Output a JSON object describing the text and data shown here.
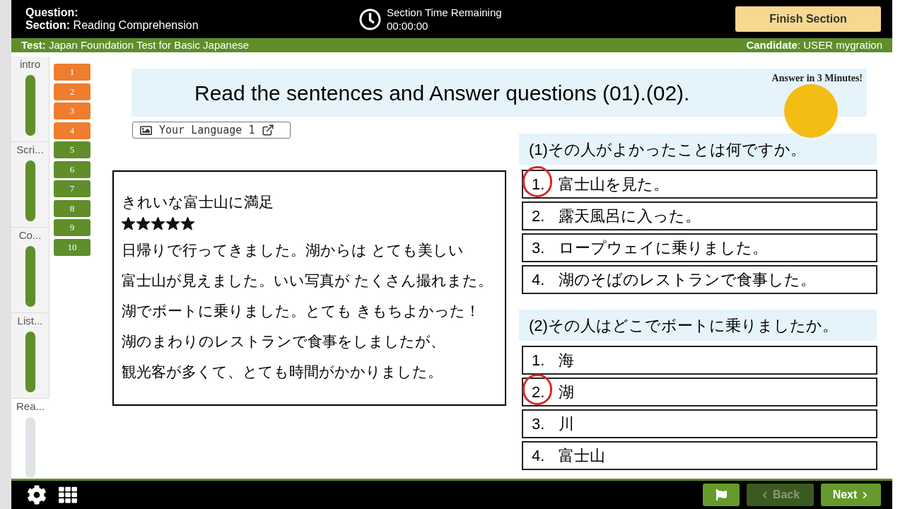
{
  "header": {
    "question_label": "Question:",
    "section": "**Section:** Reading Comprehension",
    "timer_label": "Section Time Remaining",
    "timer_value": "00:00:00",
    "finish_button": "Finish Section"
  },
  "info_bar": {
    "test": "**Test:** Japan Foundation Test for Basic Japanese",
    "candidate": "**Candidate**: USER mygration"
  },
  "sections": [
    {
      "label": "intro",
      "completed": true,
      "selected": false
    },
    {
      "label": "Scri...",
      "completed": true,
      "selected": false
    },
    {
      "label": "Co...",
      "completed": true,
      "selected": false
    },
    {
      "label": "List...",
      "completed": true,
      "selected": false
    },
    {
      "label": "Rea...",
      "completed": false,
      "selected": true
    }
  ],
  "question_nav": [
    {
      "label": "1",
      "color": "#ee7d2e"
    },
    {
      "label": "2",
      "color": "#ee7d2e"
    },
    {
      "label": "3",
      "color": "#ee7d2e"
    },
    {
      "label": "4",
      "color": "#ee7d2e"
    },
    {
      "label": "5",
      "color": "#5f8e2b"
    },
    {
      "label": "6",
      "color": "#5f8e2b"
    },
    {
      "label": "7",
      "color": "#5f8e2b"
    },
    {
      "label": "8",
      "color": "#5f8e2b"
    },
    {
      "label": "9",
      "color": "#5f8e2b"
    },
    {
      "label": "10",
      "color": "#5f8e2b"
    }
  ],
  "instruction": {
    "title": "Read the sentences and Answer questions (01).(02).",
    "time_note": "Answer in 3 Minutes!"
  },
  "language_button": {
    "label": "Your Language 1"
  },
  "passage": {
    "title": "きれいな富士山に満足",
    "stars": 5,
    "lines": [
      "日帰りで行ってきました。湖からは とても美しい",
      "富士山が見えました。いい写真が たくさん撮れまた。",
      "湖でボートに乗りました。とても きもちよかった！",
      "湖のまわりのレストランで食事をしましたが、",
      "観光客が多くて、とても時間がかかりました。"
    ]
  },
  "questions": [
    {
      "prompt": "(1)その人がよかったことは何ですか。",
      "options": [
        {
          "number": "1.",
          "text": "富士山を見た。",
          "selected": true
        },
        {
          "number": "2.",
          "text": "露天風呂に入った。",
          "selected": false
        },
        {
          "number": "3.",
          "text": "ロープウェイに乗りました。",
          "selected": false
        },
        {
          "number": "4.",
          "text": "湖のそばのレストランで食事した。",
          "selected": false
        }
      ]
    },
    {
      "prompt": "(2)その人はどこでボートに乗りましたか。",
      "options": [
        {
          "number": "1.",
          "text": "海",
          "selected": false
        },
        {
          "number": "2.",
          "text": "湖",
          "selected": true
        },
        {
          "number": "3.",
          "text": "川",
          "selected": false
        },
        {
          "number": "4.",
          "text": "富士山",
          "selected": false
        }
      ]
    }
  ],
  "footer": {
    "back_button": {
      "label": "Back",
      "disabled": true
    },
    "next_button": {
      "label": "Next"
    }
  }
}
